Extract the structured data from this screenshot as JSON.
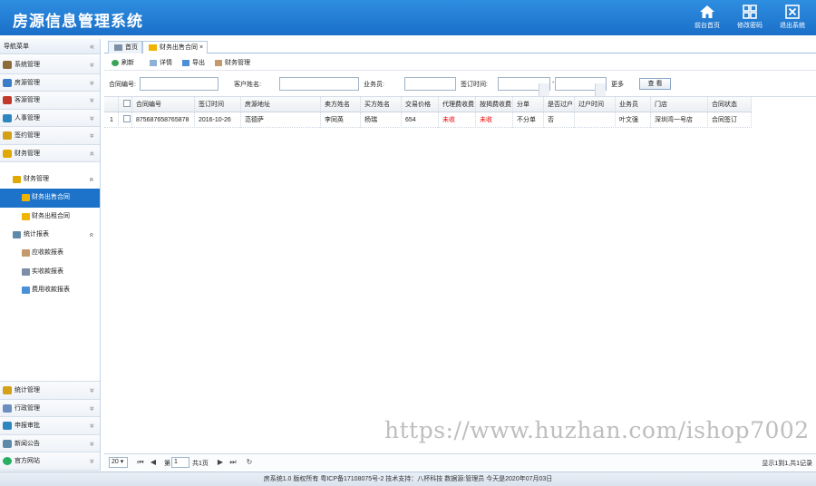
{
  "header": {
    "title": "房源信息管理系统",
    "buttons": [
      {
        "label": "前台首页",
        "icon": "home-icon"
      },
      {
        "label": "修改密码",
        "icon": "grid-icon"
      },
      {
        "label": "退出系统",
        "icon": "exit-icon"
      }
    ]
  },
  "sidebar": {
    "title": "导航菜单",
    "title_chevron": "«",
    "top_panels": [
      {
        "label": "系统管理",
        "color": "#8a6d3b"
      },
      {
        "label": "房源管理",
        "color": "#3a7dc8"
      },
      {
        "label": "客源管理",
        "color": "#c0392b"
      },
      {
        "label": "人事管理",
        "color": "#2e86c1"
      },
      {
        "label": "签约管理",
        "color": "#d4a017"
      },
      {
        "label": "财务管理",
        "color": "#e0a800"
      }
    ],
    "tree": {
      "group1": {
        "label": "财务管理"
      },
      "group1_items": [
        {
          "label": "财务出售合同"
        },
        {
          "label": "财务出租合同"
        }
      ],
      "group2": {
        "label": "统计报表"
      },
      "group2_items": [
        {
          "label": "应收款报表"
        },
        {
          "label": "实收款报表"
        },
        {
          "label": "费用收款报表"
        }
      ]
    },
    "bottom_panels": [
      {
        "label": "统计管理",
        "color": "#d4a017"
      },
      {
        "label": "行政管理",
        "color": "#6c8ebf"
      },
      {
        "label": "申报审批",
        "color": "#2e86c1"
      },
      {
        "label": "新闻公告",
        "color": "#5d8aa8"
      },
      {
        "label": "官方网站",
        "color": "#27ae60"
      }
    ],
    "chevron_down": "»",
    "chevron_up": "«"
  },
  "tabs": [
    {
      "label": "首页"
    },
    {
      "label": "财务出售合同",
      "close": "×"
    }
  ],
  "toolbar": {
    "refresh": "刷新",
    "detail": "详情",
    "export": "导出",
    "finance": "财务管理"
  },
  "search": {
    "contract_no_label": "合同编号:",
    "customer_label": "客户姓名:",
    "salesman_label": "业务员:",
    "sign_time_label": "签订时间:",
    "dash": "-",
    "more_label": "更多",
    "query_button": "查 看"
  },
  "table": {
    "columns": [
      "合同编号",
      "签订时间",
      "房源地址",
      "卖方姓名",
      "买方姓名",
      "交易价格",
      "代理费收费",
      "按揭费收费",
      "分单",
      "是否过户",
      "过户时间",
      "业务员",
      "门店",
      "合同状态"
    ],
    "rows": [
      {
        "index": "1",
        "contract_no": "875687658765878",
        "sign_time": "2016-10-26",
        "address": "范德萨",
        "seller": "李同英",
        "buyer": "杨瑞",
        "price": "654",
        "agent_fee": "未收",
        "mortgage_fee": "未收",
        "split": "不分单",
        "transferred": "否",
        "transfer_time": "",
        "salesman": "叶文强",
        "store": "深圳湾一号店",
        "status": "合同签订"
      }
    ]
  },
  "pager": {
    "page_size": "20",
    "page_prefix": "第",
    "page_value": "1",
    "page_suffix": "共1页",
    "summary": "显示1到1,共1记录"
  },
  "watermark": "https://www.huzhan.com/ishop7002",
  "footer": "房系统1.0   版权所有 粤ICP备17108075号-2   技术支持：八杯科技   数据源:管理员   今天是2020年07月03日",
  "colors": {
    "accent": "#1c73c9",
    "header": "#2a86d9",
    "red_text": "#e00000"
  }
}
